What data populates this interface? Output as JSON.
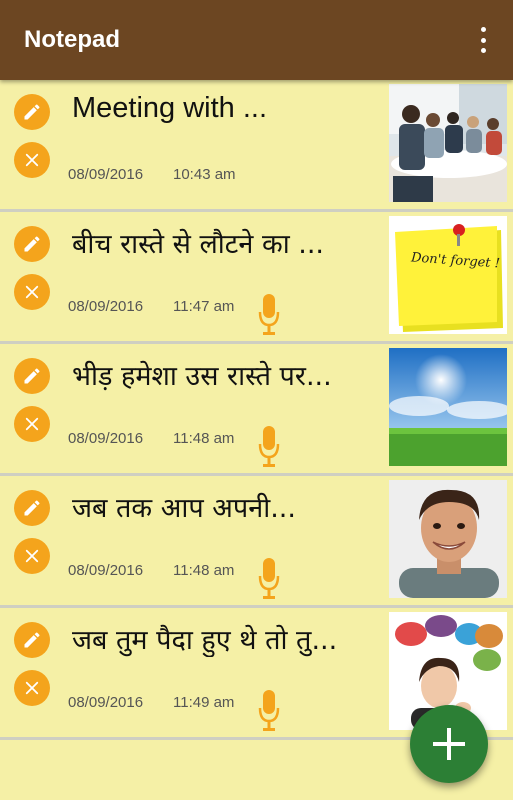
{
  "appbar": {
    "title": "Notepad",
    "background_color": "#6c4622",
    "overflow_icon": "more-vert-icon"
  },
  "notes": [
    {
      "title": "Meeting with ...",
      "date": "08/09/2016",
      "time": "10:43 am",
      "has_audio": false,
      "thumbnail": "meeting-photo"
    },
    {
      "title": "बीच रास्ते से लौटने का ...",
      "date": "08/09/2016",
      "time": "11:47 am",
      "has_audio": true,
      "thumbnail": "dont-forget-sticky-note"
    },
    {
      "title": "भीड़ हमेशा उस रास्ते पर...",
      "date": "08/09/2016",
      "time": "11:48 am",
      "has_audio": true,
      "thumbnail": "sky-grass-photo"
    },
    {
      "title": "जब तक आप अपनी...",
      "date": "08/09/2016",
      "time": "11:48 am",
      "has_audio": true,
      "thumbnail": "smiling-man-photo"
    },
    {
      "title": "जब तुम पैदा हुए थे तो तु...",
      "date": "08/09/2016",
      "time": "11:49 am",
      "has_audio": true,
      "thumbnail": "thinking-woman-speech-bubbles"
    }
  ],
  "sticky_note_text": "Don't forget !",
  "colors": {
    "list_background": "#f5f0a6",
    "action_button": "#f4a41c",
    "mic": "#f4a41c",
    "fab": "#2c7f35"
  },
  "fab": {
    "icon": "plus-icon"
  }
}
